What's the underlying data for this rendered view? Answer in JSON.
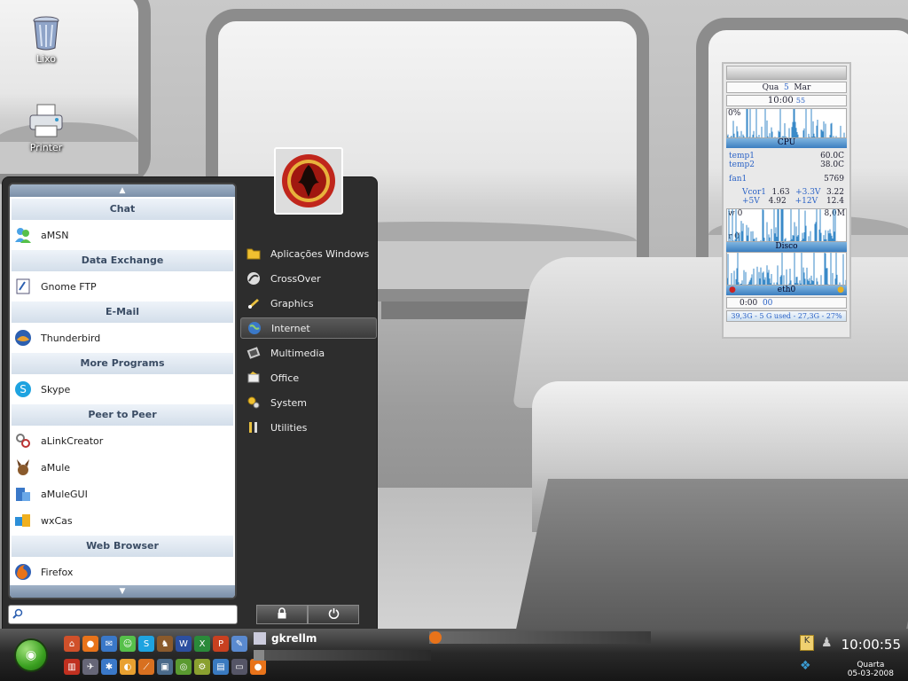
{
  "desktop": {
    "icons": [
      {
        "label": "Lixo",
        "icon": "trash-icon"
      },
      {
        "label": "Printer",
        "icon": "printer-icon"
      }
    ]
  },
  "menu": {
    "favorites": [
      {
        "category": "Chat",
        "apps": [
          "aMSN"
        ]
      },
      {
        "category": "Data Exchange",
        "apps": [
          "Gnome FTP"
        ]
      },
      {
        "category": "E-Mail",
        "apps": [
          "Thunderbird"
        ]
      },
      {
        "category": "More Programs",
        "apps": [
          "Skype"
        ]
      },
      {
        "category": "Peer to Peer",
        "apps": [
          "aLinkCreator",
          "aMule",
          "aMuleGUI",
          "wxCas"
        ]
      },
      {
        "category": "Web Browser",
        "apps": [
          "Firefox"
        ]
      }
    ],
    "scroll_up": "▲",
    "scroll_down": "▼",
    "search_placeholder": "",
    "sections": [
      {
        "label": "Aplicações Windows",
        "icon": "folder-icon",
        "active": false
      },
      {
        "label": "CrossOver",
        "icon": "crossover-icon",
        "active": false
      },
      {
        "label": "Graphics",
        "icon": "graphics-icon",
        "active": false
      },
      {
        "label": "Internet",
        "icon": "globe-icon",
        "active": true
      },
      {
        "label": "Multimedia",
        "icon": "multimedia-icon",
        "active": false
      },
      {
        "label": "Office",
        "icon": "office-icon",
        "active": false
      },
      {
        "label": "System",
        "icon": "system-icon",
        "active": false
      },
      {
        "label": "Utilities",
        "icon": "utilities-icon",
        "active": false
      }
    ],
    "lock_icon": "lock-icon",
    "power_icon": "power-icon"
  },
  "gkrellm": {
    "day": "Qua",
    "date_num": "5",
    "month": "Mar",
    "time": "10:00",
    "seconds": "55",
    "cpu_pct": "0%",
    "cpu_label": "CPU",
    "temp1_label": "temp1",
    "temp1": "60.0C",
    "temp2_label": "temp2",
    "temp2": "38.0C",
    "fan1_label": "fan1",
    "fan1": "5769",
    "vcor1_label": "Vcor1",
    "vcor1": "1.63",
    "v33_label": "+3.3V",
    "v33": "3.22",
    "v5_label": "+5V",
    "v5": "4.92",
    "v12_label": "+12V",
    "v12": "12.4",
    "disk_w": "w 0",
    "disk_max": "8,0M",
    "disk_r": "r 0",
    "disk_label": "Disco",
    "net_label": "eth0",
    "net_time": "0:00",
    "net_time_sec": "00",
    "fs_line": "39,3G - 5 G used - 27,3G - 27%"
  },
  "taskbar": {
    "tasks": [
      {
        "label": "gkrellm",
        "icon": "gkrellm-icon"
      }
    ],
    "clock": "10:00:55",
    "day_name": "Quarta",
    "date": "05-03-2008"
  }
}
